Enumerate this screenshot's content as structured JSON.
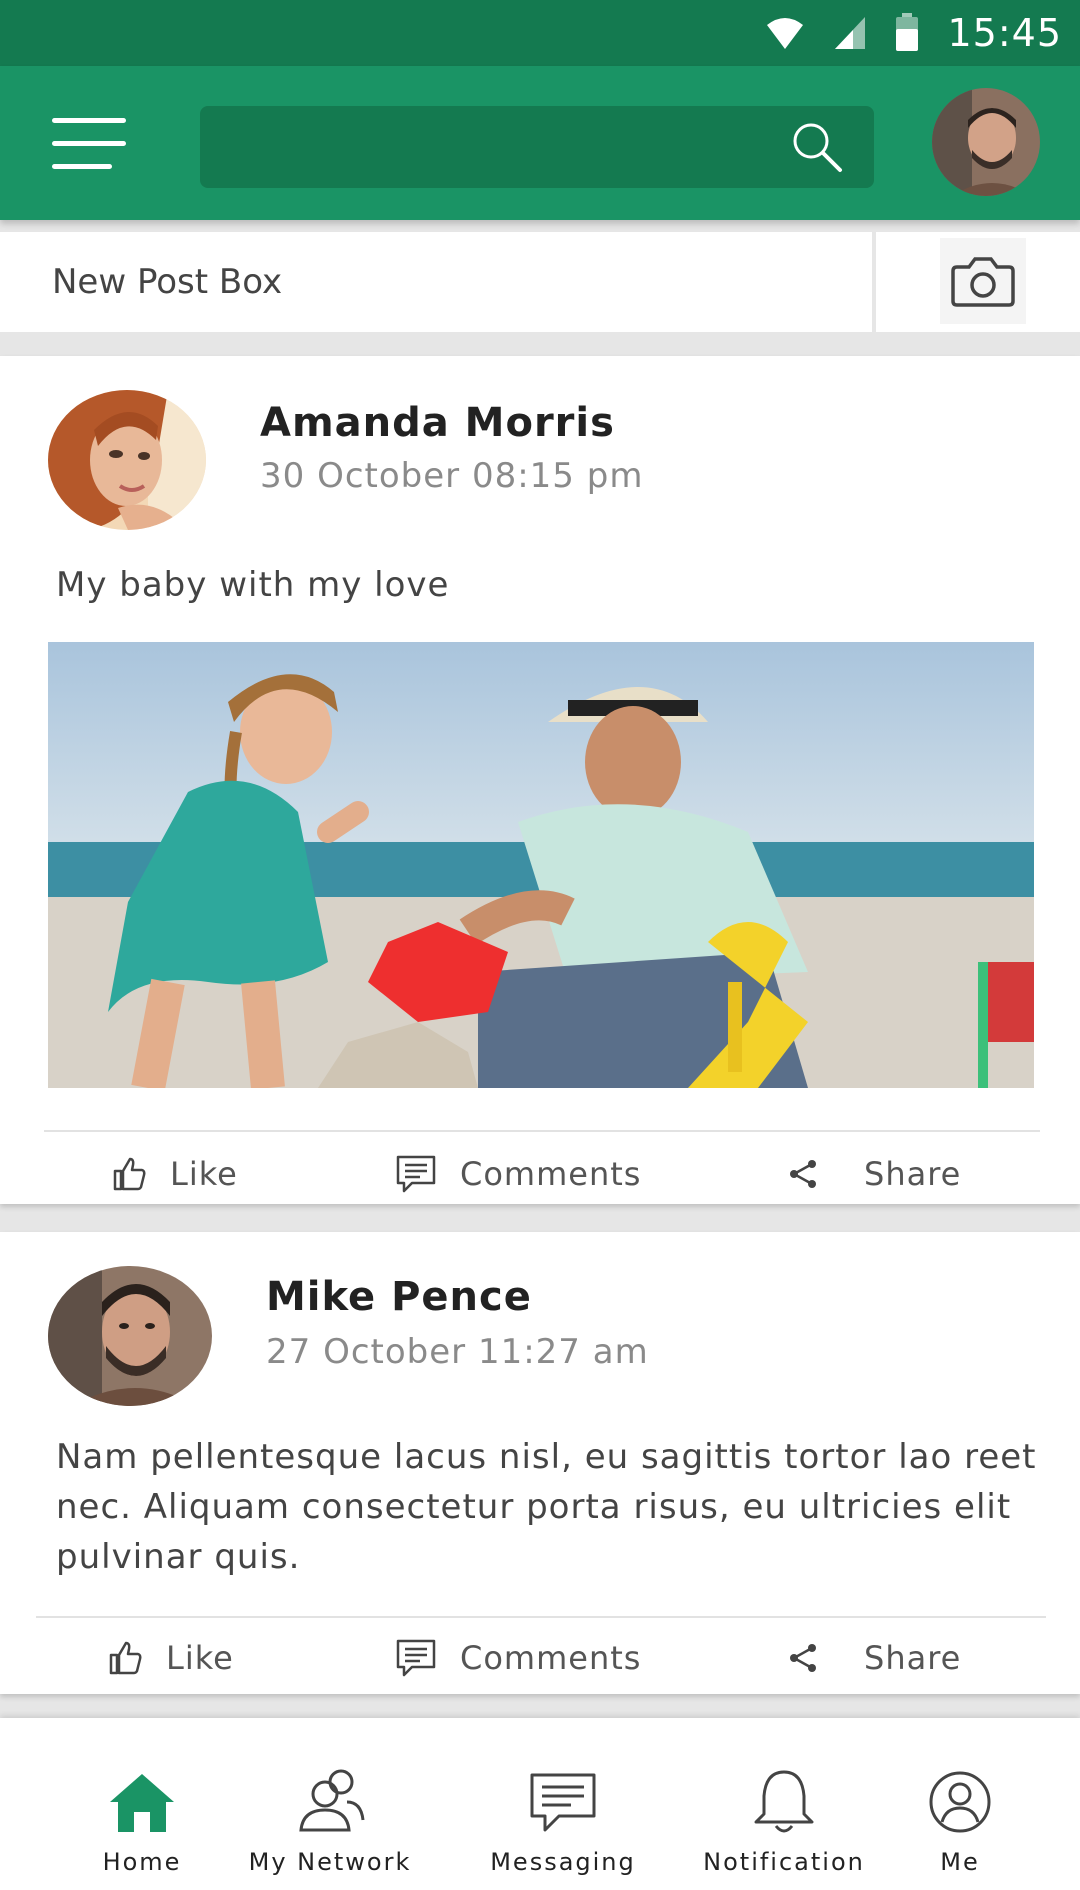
{
  "status_bar": {
    "time": "15:45",
    "icons": [
      "wifi-icon",
      "signal-icon",
      "battery-icon"
    ]
  },
  "header": {
    "menu_icon": "hamburger-menu-icon",
    "search_placeholder": "",
    "search_icon": "search-icon",
    "avatar": "profile-avatar"
  },
  "new_post": {
    "label": "New Post Box",
    "camera_icon": "camera-icon"
  },
  "posts": [
    {
      "author": "Amanda Morris",
      "timestamp": "30 October 08:15 pm",
      "text": "My baby with my love",
      "has_image": true,
      "actions": {
        "like": "Like",
        "comments": "Comments",
        "share": "Share"
      }
    },
    {
      "author": "Mike Pence",
      "timestamp": "27 October 11:27 am",
      "text": "Nam pellentesque lacus nisl, eu sagittis tortor lao reet nec. Aliquam consectetur porta risus, eu ultricies elit pulvinar quis.",
      "has_image": false,
      "actions": {
        "like": "Like",
        "comments": "Comments",
        "share": "Share"
      }
    }
  ],
  "bottom_nav": {
    "active": "Home",
    "items": [
      {
        "label": "Home",
        "icon": "home-icon"
      },
      {
        "label": "My Network",
        "icon": "network-icon"
      },
      {
        "label": "Messaging",
        "icon": "messaging-icon"
      },
      {
        "label": "Notification",
        "icon": "bell-icon"
      },
      {
        "label": "Me",
        "icon": "user-icon"
      }
    ]
  },
  "colors": {
    "status_bar": "#147a50",
    "app_bar": "#1a9465",
    "search_bg": "#147a50",
    "active_nav": "#1a9465"
  }
}
